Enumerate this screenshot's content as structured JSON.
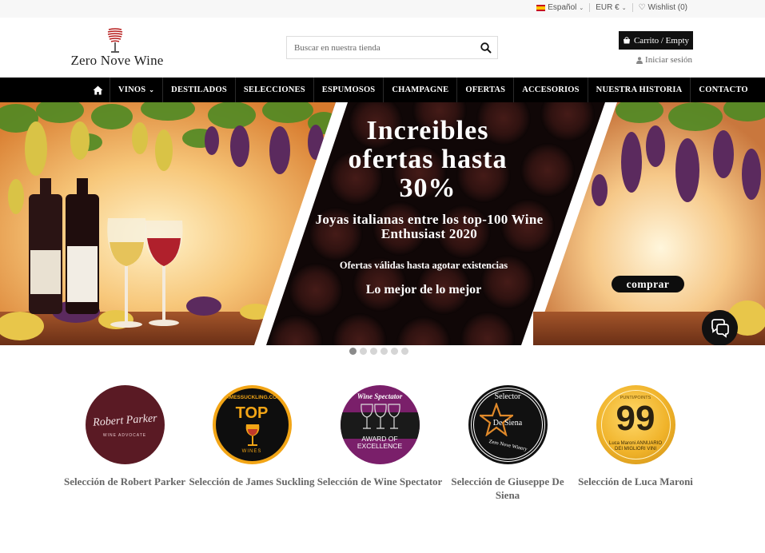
{
  "topbar": {
    "language": "Español",
    "currency": "EUR €",
    "wishlist": "Wishlist (0)"
  },
  "header": {
    "logo_text": "Zero Nove Wine",
    "search_placeholder": "Buscar en nuestra tienda",
    "cart_label": "Carrito / Empty",
    "login_label": "Iniciar sesión"
  },
  "nav": {
    "items": [
      "VINOS",
      "DESTILADOS",
      "SELECCIONES",
      "ESPUMOSOS",
      "CHAMPAGNE",
      "OFERTAS",
      "ACCESORIOS",
      "NUESTRA HISTORIA",
      "CONTACTO"
    ]
  },
  "hero": {
    "title": "Increibles ofertas hasta 30%",
    "subtitle": "Joyas italianas entre los top-100 Wine Enthusiast 2020",
    "offer_note": "Ofertas válidas hasta agotar existencias",
    "tagline": "Lo mejor de lo mejor",
    "buy_button": "comprar",
    "slide_count": 6,
    "active_slide": 1
  },
  "selections": [
    {
      "label": "Selección de Robert Parker",
      "badge": {
        "title": "Robert Parker",
        "subtitle": "WINE ADVOCATE"
      }
    },
    {
      "label": "Selección de James Suckling",
      "badge": {
        "title": "JAMESSUCKLING.COM",
        "main": "TOP",
        "sub": "WINES"
      }
    },
    {
      "label": "Selección de Wine Spectator",
      "badge": {
        "title": "Wine Spectator",
        "main": "AWARD OF EXCELLENCE"
      }
    },
    {
      "label": "Selección de Giuseppe De Siena",
      "badge": {
        "title": "Selector",
        "main": "De Siena",
        "sub": "Zero Nove Winery"
      }
    },
    {
      "label": "Selección de Luca Maroni",
      "badge": {
        "title": "PUNTI/POINTS",
        "main": "99",
        "sub": "Luca Maroni ANNUARIO DEI MIGLIORI VINI"
      }
    }
  ],
  "colors": {
    "nav_bg": "#000000",
    "accent_dark": "#111111",
    "parker_badge": "#5a1a24",
    "suckling_gold": "#f2a516",
    "spectator_purple": "#7a1f6a",
    "maroni_gold": "#f0b32a"
  }
}
